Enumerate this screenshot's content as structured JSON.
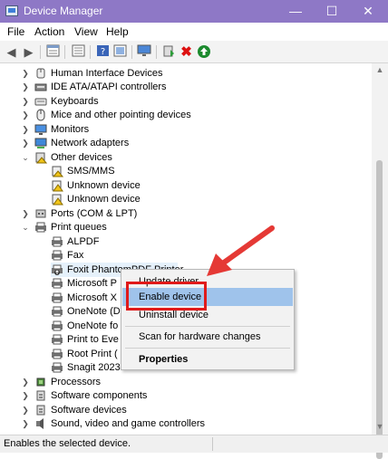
{
  "window": {
    "title": "Device Manager",
    "minimize": "—",
    "maximize": "☐",
    "close": "✕"
  },
  "menu": [
    "File",
    "Action",
    "View",
    "Help"
  ],
  "toolbar_icons": [
    "back-arrow",
    "forward-arrow",
    "properties",
    "device-list",
    "help",
    "view-hidden",
    "monitor",
    "update-driver",
    "uninstall",
    "enable"
  ],
  "tree": {
    "items": [
      {
        "label": "Human Interface Devices",
        "icon": "hid-icon",
        "expanded": false
      },
      {
        "label": "IDE ATA/ATAPI controllers",
        "icon": "ide-icon",
        "expanded": false
      },
      {
        "label": "Keyboards",
        "icon": "keyboard-icon",
        "expanded": false
      },
      {
        "label": "Mice and other pointing devices",
        "icon": "mouse-icon",
        "expanded": false
      },
      {
        "label": "Monitors",
        "icon": "monitor-icon",
        "expanded": false
      },
      {
        "label": "Network adapters",
        "icon": "network-icon",
        "expanded": false
      },
      {
        "label": "Other devices",
        "icon": "other-devices-icon",
        "expanded": true
      },
      {
        "label": "SMS/MMS",
        "icon": "sms-icon",
        "child": true
      },
      {
        "label": "Unknown device",
        "icon": "warning-icon",
        "child": true
      },
      {
        "label": "Unknown device",
        "icon": "warning-icon",
        "child": true
      },
      {
        "label": "Ports (COM & LPT)",
        "icon": "port-icon",
        "expanded": false
      },
      {
        "label": "Print queues",
        "icon": "printer-icon",
        "expanded": true
      },
      {
        "label": "ALPDF",
        "icon": "printer-icon",
        "child": true
      },
      {
        "label": "Fax",
        "icon": "printer-icon",
        "child": true
      },
      {
        "label": "Foxit PhantomPDF Printer",
        "icon": "printer-disabled-icon",
        "child": true,
        "selected": true
      },
      {
        "label": "Microsoft P",
        "icon": "printer-icon",
        "child": true
      },
      {
        "label": "Microsoft X",
        "icon": "printer-icon",
        "child": true
      },
      {
        "label": "OneNote (D",
        "icon": "printer-icon",
        "child": true
      },
      {
        "label": "OneNote fo",
        "icon": "printer-icon",
        "child": true
      },
      {
        "label": "Print to Eve",
        "icon": "printer-icon",
        "child": true
      },
      {
        "label": "Root Print (",
        "icon": "printer-icon",
        "child": true
      },
      {
        "label": "Snagit 2023",
        "icon": "printer-icon",
        "child": true
      },
      {
        "label": "Processors",
        "icon": "processor-icon",
        "expanded": false
      },
      {
        "label": "Software components",
        "icon": "software-component-icon",
        "expanded": false
      },
      {
        "label": "Software devices",
        "icon": "software-device-icon",
        "expanded": false
      },
      {
        "label": "Sound, video and game controllers",
        "icon": "sound-icon",
        "expanded": false
      }
    ]
  },
  "context_menu": {
    "update_driver": "Update driver",
    "enable_device": "Enable device",
    "uninstall_device": "Uninstall device",
    "scan": "Scan for hardware changes",
    "properties": "Properties"
  },
  "status": {
    "text": "Enables the selected device."
  },
  "colors": {
    "titlebar": "#8e78c6",
    "highlight": "#9fc3eb",
    "annotation": "#e01a1a"
  }
}
